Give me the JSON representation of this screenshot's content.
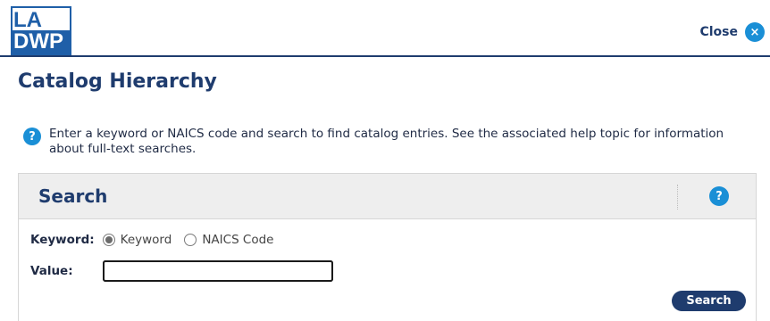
{
  "header": {
    "logo_top": "LA",
    "logo_bottom": "DWP",
    "close_label": "Close",
    "close_icon": "close-icon"
  },
  "page_title": "Catalog Hierarchy",
  "help": {
    "icon": "help-icon",
    "text": "Enter a keyword or NAICS code and search to find catalog entries. See the associated help topic for information about full-text searches."
  },
  "search_panel": {
    "title": "Search",
    "help_icon": "help-icon",
    "keyword_label": "Keyword:",
    "options": [
      {
        "label": "Keyword",
        "selected": true
      },
      {
        "label": "NAICS Code",
        "selected": false
      }
    ],
    "value_label": "Value:",
    "value": "",
    "search_button": "Search"
  },
  "colors": {
    "brand_navy": "#1f3c6e",
    "accent_blue": "#1a8fd6",
    "logo_blue": "#1f5fa8",
    "panel_header_bg": "#eeeeee"
  }
}
